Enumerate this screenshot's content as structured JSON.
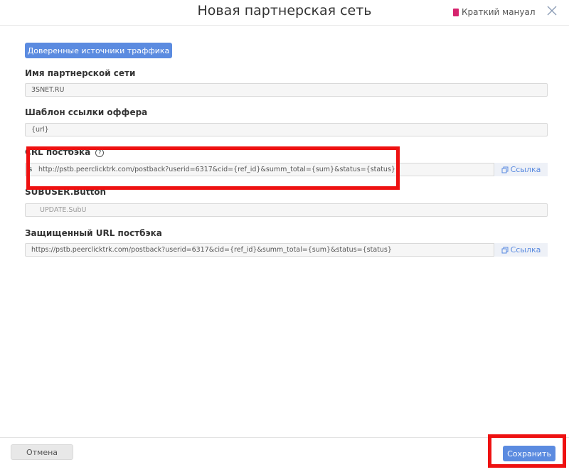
{
  "header": {
    "title": "Новая партнерская сеть",
    "manual_link": "Краткий мануал",
    "accent_color": "#d6246e"
  },
  "trust_button": {
    "label": "Доверенные источники траффика"
  },
  "fields": {
    "network_name": {
      "label": "Имя партнерской сети",
      "value": "3SNET.RU"
    },
    "offer_template": {
      "label": "Шаблон ссылки оффера",
      "value": "{url}"
    },
    "postback_url": {
      "label_prefix": "C",
      "label": "RL постбэка",
      "help_icon": "?",
      "value": "http://pstb.peerclicktrk.com/postback?userid=6317&cid={ref_id}&summ_total={sum}&status={status}",
      "link_label": "Ссылка",
      "side_letter": "s"
    },
    "subuser": {
      "label": "SUBUSER.Button",
      "value": "UPDATE.SubU"
    },
    "secure_postback_url": {
      "label": "Защищенный URL постбэка",
      "value": "https://pstb.peerclicktrk.com/postback?userid=6317&cid={ref_id}&summ_total={sum}&status={status}",
      "link_label": "Ссылка"
    }
  },
  "footer": {
    "cancel_label": "Отмена",
    "save_label": "Сохранить"
  },
  "colors": {
    "primary": "#5b8be0",
    "highlight": "#ee1111"
  }
}
